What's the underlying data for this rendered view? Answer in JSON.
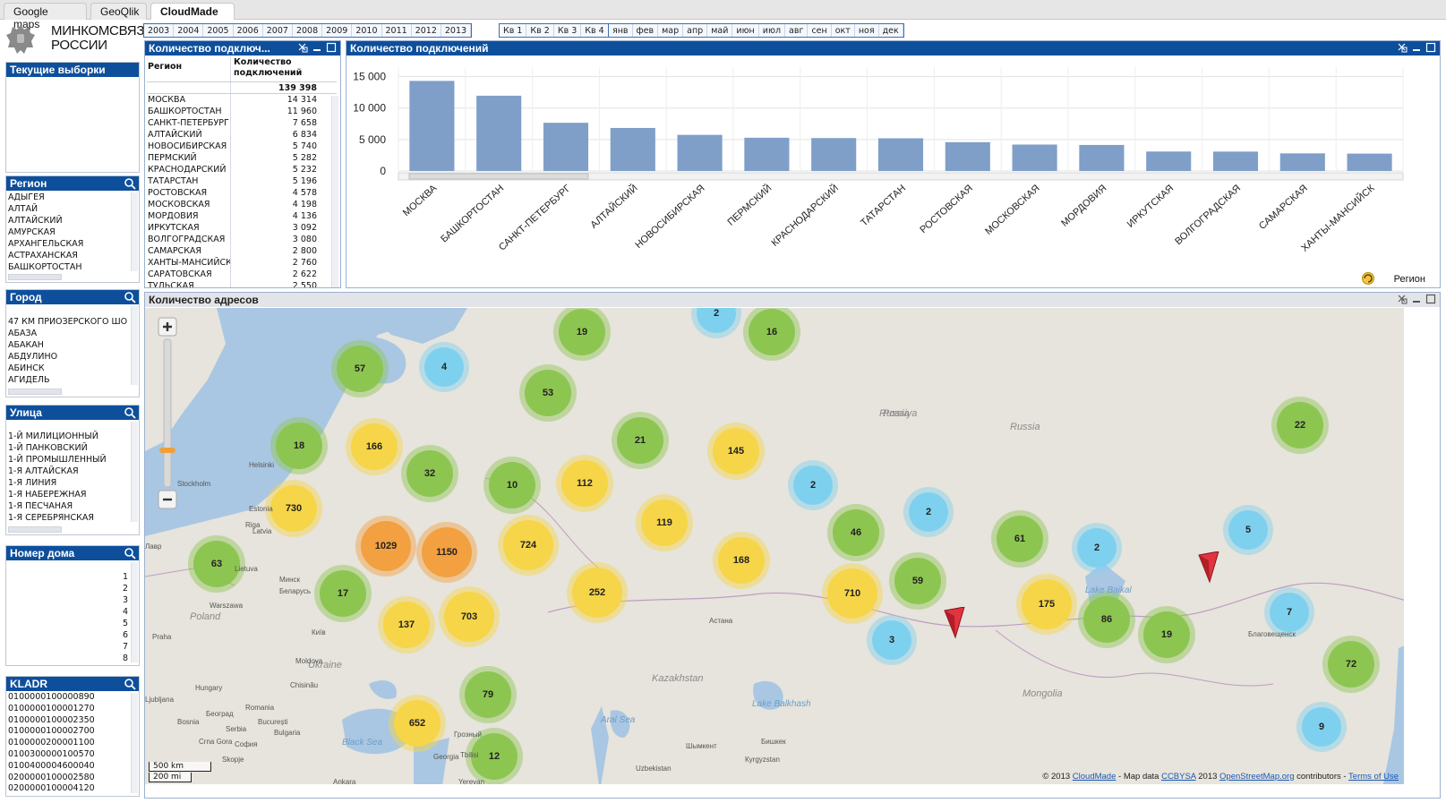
{
  "app_tabs": [
    "Google maps",
    "GeoQlik",
    "CloudMade"
  ],
  "active_tab": "CloudMade",
  "years": [
    "2003",
    "2004",
    "2005",
    "2006",
    "2007",
    "2008",
    "2009",
    "2010",
    "2011",
    "2012",
    "2013"
  ],
  "quarters": [
    "Кв 1",
    "Кв 2",
    "Кв 3",
    "Кв 4"
  ],
  "months": [
    "янв",
    "фев",
    "мар",
    "апр",
    "май",
    "июн",
    "июл",
    "авг",
    "сен",
    "окт",
    "ноя",
    "дек"
  ],
  "logo": {
    "text": "МИНКОМСВЯЗЬ\nРОССИИ"
  },
  "current_selections": {
    "title": "Текущие выборки"
  },
  "region_list": {
    "title": "Регион",
    "items": [
      "АДЫГЕЯ",
      "АЛТАЙ",
      "АЛТАЙСКИЙ",
      "АМУРСКАЯ",
      "АРХАНГЕЛЬСКАЯ",
      "АСТРАХАНСКАЯ",
      "БАШКОРТОСТАН"
    ]
  },
  "city_list": {
    "title": "Город",
    "items": [
      "47 КМ ПРИОЗЕРСКОГО ШО",
      "АБАЗА",
      "АБАКАН",
      "АБДУЛИНО",
      "АБИНСК",
      "АГИДЕЛЬ"
    ]
  },
  "street_list": {
    "title": "Улица",
    "items": [
      "1-Й МИЛИЦИОННЫЙ",
      "1-Й ПАНКОВСКИЙ",
      "1-Й ПРОМЫШЛЕННЫЙ",
      "1-Я АЛТАЙСКАЯ",
      "1-Я ЛИНИЯ",
      "1-Я НАБЕРЕЖНАЯ",
      "1-Я ПЕСЧАНАЯ",
      "1-Я СЕРЕБРЯНСКАЯ"
    ]
  },
  "house_list": {
    "title": "Номер дома",
    "items": [
      "1",
      "2",
      "3",
      "4",
      "5",
      "6",
      "7",
      "8"
    ]
  },
  "kladr_list": {
    "title": "KLADR",
    "items": [
      "0100000100000890",
      "0100000100001270",
      "0100000100002350",
      "0100000100002700",
      "0100000200001100",
      "0100300000100570",
      "0100400004600040",
      "0200000100002580",
      "0200000100004120"
    ]
  },
  "table_panel": {
    "title": "Количество подключ...",
    "col_region": "Регион",
    "col_count": "Количество подключений",
    "total": "139 398",
    "rows": [
      [
        "МОСКВА",
        "14 314"
      ],
      [
        "БАШКОРТОСТАН",
        "11 960"
      ],
      [
        "САНКТ-ПЕТЕРБУРГ",
        "7 658"
      ],
      [
        "АЛТАЙСКИЙ",
        "6 834"
      ],
      [
        "НОВОСИБИРСКАЯ",
        "5 740"
      ],
      [
        "ПЕРМСКИЙ",
        "5 282"
      ],
      [
        "КРАСНОДАРСКИЙ",
        "5 232"
      ],
      [
        "ТАТАРСТАН",
        "5 196"
      ],
      [
        "РОСТОВСКАЯ",
        "4 578"
      ],
      [
        "МОСКОВСКАЯ",
        "4 198"
      ],
      [
        "МОРДОВИЯ",
        "4 136"
      ],
      [
        "ИРКУТСКАЯ",
        "3 092"
      ],
      [
        "ВОЛГОГРАДСКАЯ",
        "3 080"
      ],
      [
        "САМАРСКАЯ",
        "2 800"
      ],
      [
        "ХАНТЫ-МАНСИЙСК",
        "2 760"
      ],
      [
        "САРАТОВСКАЯ",
        "2 622"
      ],
      [
        "ТУЛЬСКАЯ",
        "2 550"
      ]
    ]
  },
  "chart_panel": {
    "title": "Количество подключений",
    "dimension_label": "Регион"
  },
  "chart_data": {
    "type": "bar",
    "categories": [
      "МОСКВА",
      "БАШКОРТОСТАН",
      "САНКТ-ПЕТЕРБУРГ",
      "АЛТАЙСКИЙ",
      "НОВОСИБИРСКАЯ",
      "ПЕРМСКИЙ",
      "КРАСНОДАРСКИЙ",
      "ТАТАРСТАН",
      "РОСТОВСКАЯ",
      "МОСКОВСКАЯ",
      "МОРДОВИЯ",
      "ИРКУТСКАЯ",
      "ВОЛГОГРАДСКАЯ",
      "САМАРСКАЯ",
      "ХАНТЫ-МАНСИЙСК"
    ],
    "values": [
      14314,
      11960,
      7658,
      6834,
      5740,
      5282,
      5232,
      5196,
      4578,
      4198,
      4136,
      3092,
      3080,
      2800,
      2760
    ],
    "yticks": [
      "15 000",
      "10 000",
      "5 000",
      "0"
    ],
    "ylim": [
      0,
      16500
    ],
    "grid": true,
    "bar_color": "#7f9fc8"
  },
  "map_panel": {
    "title": "Количество адресов",
    "clusters": [
      {
        "label": "2",
        "color": "b"
      },
      {
        "label": "19",
        "color": "g"
      },
      {
        "label": "16",
        "color": "g"
      },
      {
        "label": "57",
        "color": "g"
      },
      {
        "label": "4",
        "color": "b"
      },
      {
        "label": "53",
        "color": "g"
      },
      {
        "label": "18",
        "color": "g"
      },
      {
        "label": "166",
        "color": "y"
      },
      {
        "label": "32",
        "color": "g"
      },
      {
        "label": "21",
        "color": "g"
      },
      {
        "label": "145",
        "color": "y"
      },
      {
        "label": "22",
        "color": "g"
      },
      {
        "label": "10",
        "color": "g"
      },
      {
        "label": "112",
        "color": "y"
      },
      {
        "label": "2",
        "color": "b"
      },
      {
        "label": "730",
        "color": "y"
      },
      {
        "label": "119",
        "color": "y"
      },
      {
        "label": "2",
        "color": "b"
      },
      {
        "label": "46",
        "color": "g"
      },
      {
        "label": "61",
        "color": "g"
      },
      {
        "label": "2",
        "color": "b"
      },
      {
        "label": "5",
        "color": "b"
      },
      {
        "label": "63",
        "color": "g"
      },
      {
        "label": "1029",
        "color": "o"
      },
      {
        "label": "1150",
        "color": "o"
      },
      {
        "label": "724",
        "color": "y"
      },
      {
        "label": "168",
        "color": "y"
      },
      {
        "label": "17",
        "color": "g"
      },
      {
        "label": "252",
        "color": "y"
      },
      {
        "label": "710",
        "color": "y"
      },
      {
        "label": "59",
        "color": "g"
      },
      {
        "label": "175",
        "color": "y"
      },
      {
        "label": "137",
        "color": "y"
      },
      {
        "label": "703",
        "color": "y"
      },
      {
        "label": "86",
        "color": "g"
      },
      {
        "label": "7",
        "color": "b"
      },
      {
        "label": "3",
        "color": "b"
      },
      {
        "label": "19",
        "color": "g"
      },
      {
        "label": "72",
        "color": "g"
      },
      {
        "label": "79",
        "color": "g"
      },
      {
        "label": "652",
        "color": "y"
      },
      {
        "label": "12",
        "color": "g"
      },
      {
        "label": "9",
        "color": "b"
      }
    ],
    "place_labels": [
      "Helsinki",
      "Stockholm",
      "Riga",
      "Минск",
      "Warszawa",
      "Київ",
      "Praha",
      "Chisinău",
      "Бeoград",
      "București",
      "София",
      "Ljubljana",
      "Роssiya",
      "Астана",
      "Бишкек",
      "Грозный",
      "Ankara",
      "Благовещенск",
      "Лавр",
      "Kazakhstan",
      "Mongolia",
      "Ukraine",
      "Poland",
      "Russia",
      "Russia",
      "Estonia",
      "Lietuva",
      "Romania",
      "Black Sea",
      "Aral Sea",
      "Lake Balkhash",
      "Lake Baikal",
      "Шымкент",
      "Georgia",
      "Uzbekistan",
      "Tbilisi",
      "Yerevan",
      "Hungary",
      "Кyrgyzstan",
      "Беларусь",
      "Latvia",
      "Bosnia",
      "Serbia",
      "Crna Gora",
      "Bulgaria",
      "Skopje",
      "Moldova"
    ],
    "scale_km": "500 km",
    "scale_mi": "200 mi",
    "attribution_prefix": "© 2013",
    "attr_cloudmade": "CloudMade",
    "attr_mid": "- Map data",
    "attr_ccbysa": "CCBYSA",
    "attr_year": "2013",
    "attr_osm": "OpenStreetMap.org",
    "attr_contrib": "contributors -",
    "attr_terms": "Terms of Use"
  }
}
